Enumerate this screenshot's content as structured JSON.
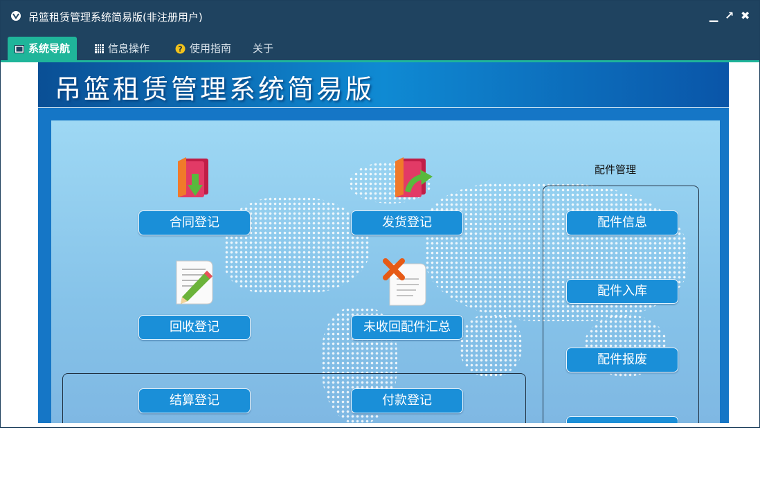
{
  "window": {
    "title": "吊篮租赁管理系统简易版(非注册用户)",
    "controls": {
      "minimize": "▁",
      "restore": "↗",
      "close": "✖"
    }
  },
  "menu": {
    "tabs": [
      {
        "label": "系统导航",
        "icon": "monitor-icon",
        "active": true
      },
      {
        "label": "信息操作",
        "icon": "grid-icon",
        "active": false
      },
      {
        "label": "使用指南",
        "icon": "help-icon",
        "active": false
      },
      {
        "label": "关于",
        "icon": "",
        "active": false
      }
    ]
  },
  "banner": {
    "title": "吊篮租赁管理系统简易版"
  },
  "modules": {
    "contract": {
      "label": "合同登记",
      "icon": "folder-down-arrow-icon"
    },
    "delivery": {
      "label": "发货登记",
      "icon": "folder-right-arrow-icon"
    },
    "recovery": {
      "label": "回收登记",
      "icon": "document-pencil-icon"
    },
    "unrecovered": {
      "label": "未收回配件汇总",
      "icon": "document-delete-icon"
    },
    "settlement": {
      "label": "结算登记"
    },
    "payment": {
      "label": "付款登记"
    }
  },
  "parts": {
    "group_label": "配件管理",
    "info": "配件信息",
    "stock_in": "配件入库",
    "scrap": "配件报废"
  },
  "colors": {
    "titlebar": "#1f4360",
    "tab_active": "#1fb59a",
    "button": "#1a8fd8",
    "panel": "#93cdee"
  }
}
